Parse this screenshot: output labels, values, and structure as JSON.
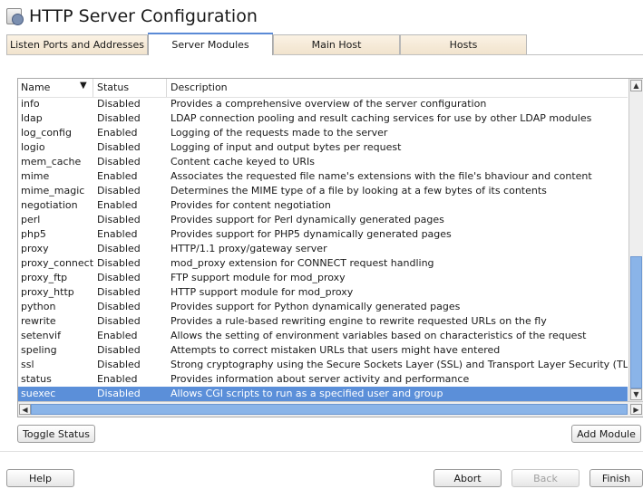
{
  "window": {
    "title": "HTTP Server Configuration"
  },
  "tabs": [
    {
      "label": "Listen Ports and Addresses",
      "active": false
    },
    {
      "label": "Server Modules",
      "active": true
    },
    {
      "label": "Main Host",
      "active": false
    },
    {
      "label": "Hosts",
      "active": false
    }
  ],
  "table": {
    "headers": {
      "name": "Name",
      "status": "Status",
      "description": "Description"
    },
    "rows": [
      {
        "name": "info",
        "status": "Disabled",
        "description": "Provides a comprehensive overview of the server configuration"
      },
      {
        "name": "ldap",
        "status": "Disabled",
        "description": "LDAP connection pooling and result caching services for use by other LDAP modules"
      },
      {
        "name": "log_config",
        "status": "Enabled",
        "description": "Logging of the requests made to the server"
      },
      {
        "name": "logio",
        "status": "Disabled",
        "description": "Logging of input and output bytes per request"
      },
      {
        "name": "mem_cache",
        "status": "Disabled",
        "description": "Content cache keyed to URIs"
      },
      {
        "name": "mime",
        "status": "Enabled",
        "description": "Associates the requested file name's extensions with the file's bhaviour and content"
      },
      {
        "name": "mime_magic",
        "status": "Disabled",
        "description": "Determines the MIME type of a file by looking at a few bytes of its contents"
      },
      {
        "name": "negotiation",
        "status": "Enabled",
        "description": "Provides for content negotiation"
      },
      {
        "name": "perl",
        "status": "Disabled",
        "description": "Provides support for Perl dynamically generated pages"
      },
      {
        "name": "php5",
        "status": "Enabled",
        "description": "Provides support for PHP5 dynamically generated pages"
      },
      {
        "name": "proxy",
        "status": "Disabled",
        "description": "HTTP/1.1 proxy/gateway server"
      },
      {
        "name": "proxy_connect",
        "status": "Disabled",
        "description": "mod_proxy extension for CONNECT request handling"
      },
      {
        "name": "proxy_ftp",
        "status": "Disabled",
        "description": "FTP support module for mod_proxy"
      },
      {
        "name": "proxy_http",
        "status": "Disabled",
        "description": "HTTP support module for mod_proxy"
      },
      {
        "name": "python",
        "status": "Disabled",
        "description": "Provides support for Python dynamically generated pages"
      },
      {
        "name": "rewrite",
        "status": "Disabled",
        "description": "Provides a rule-based rewriting engine to rewrite requested URLs on the fly"
      },
      {
        "name": "setenvif",
        "status": "Enabled",
        "description": "Allows the setting of environment variables based on characteristics of the request"
      },
      {
        "name": "speling",
        "status": "Disabled",
        "description": "Attempts to correct mistaken URLs that users might have entered"
      },
      {
        "name": "ssl",
        "status": "Disabled",
        "description": "Strong cryptography using the Secure Sockets Layer (SSL) and Transport Layer Security (TLS) p"
      },
      {
        "name": "status",
        "status": "Enabled",
        "description": "Provides information about server activity and performance"
      },
      {
        "name": "suexec",
        "status": "Disabled",
        "description": "Allows CGI scripts to run as a specified user and group",
        "selected": true
      }
    ]
  },
  "buttons": {
    "toggle_status": "Toggle Status",
    "add_module": "Add Module",
    "help": "Help",
    "abort": "Abort",
    "back": "Back",
    "finish": "Finish"
  },
  "icons": {
    "title": "server-config-icon",
    "sort": "chevron-down-icon",
    "scroll_up": "arrow-up-icon",
    "scroll_down": "arrow-down-icon",
    "scroll_left": "arrow-left-icon",
    "scroll_right": "arrow-right-icon"
  },
  "colors": {
    "selection": "#5b8fd9",
    "scroll_thumb": "#8ab4e8",
    "tab_bg": "#f1e3cd"
  }
}
